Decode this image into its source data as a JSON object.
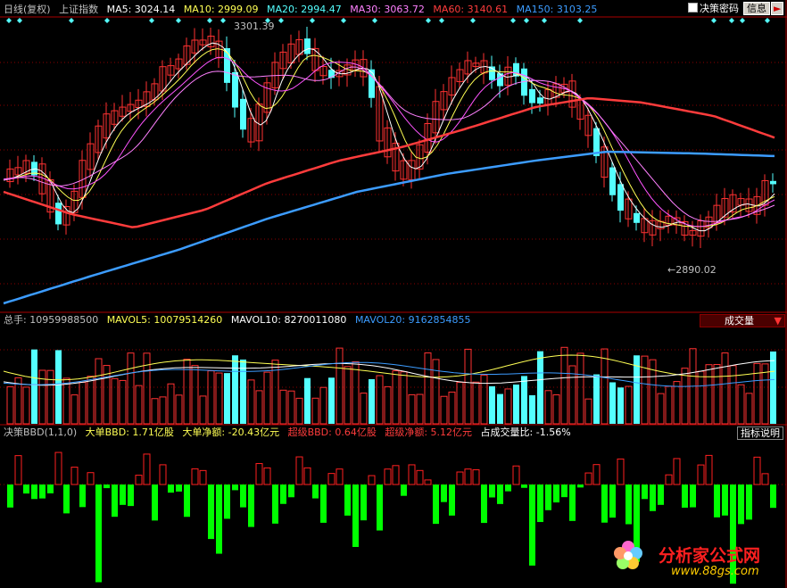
{
  "header": {
    "period": "日线(复权)",
    "index_name": "上证指数",
    "ma5": "MA5: 3024.14",
    "ma10": "MA10: 2999.09",
    "ma20": "MA20: 2994.47",
    "ma30": "MA30: 3063.72",
    "ma60": "MA60: 3140.61",
    "ma150": "MA150: 3103.25",
    "decision_code": "决策密码",
    "info_button": "信息",
    "play_button": "►"
  },
  "price_annotations": {
    "high": "3301.39",
    "low": "2890.02"
  },
  "volume": {
    "total": "总手: 10959988500",
    "mavol5": "MAVOL5: 10079514260",
    "mavol10": "MAVOL10: 8270011080",
    "mavol20": "MAVOL20: 9162854855",
    "selector": "成交量",
    "selector_arrow": "▼"
  },
  "bbd": {
    "title": "决策BBD(1,1,0)",
    "big_bbd": "大单BBD: 1.71亿股",
    "big_net": "大单净额: -20.43亿元",
    "super_bbd": "超级BBD: 0.64亿股",
    "super_net": "超级净额: 5.12亿元",
    "ratio": "占成交量比: -1.56%",
    "help_button": "指标说明"
  },
  "watermark": {
    "name": "分析家公式网",
    "url": "www.88gs.com"
  },
  "colors": {
    "up": "#ff3232",
    "down": "#54ffff",
    "ma5": "#ffffff",
    "ma10": "#ffff54",
    "ma20": "#ff54ff",
    "ma30": "#ff80ff",
    "ma60": "#ff3c3c",
    "ma150": "#3c9cff",
    "bbd_pos": "#ff2020",
    "bbd_neg": "#00ff00",
    "grid": "#8b0000"
  },
  "chart_data": {
    "type": "candlestick",
    "price_range": [
      2890.02,
      3301.39
    ],
    "volume_ma": [
      "MAVOL5",
      "MAVOL10",
      "MAVOL20"
    ],
    "bbd_series_sample": "positive/negative histogram"
  }
}
